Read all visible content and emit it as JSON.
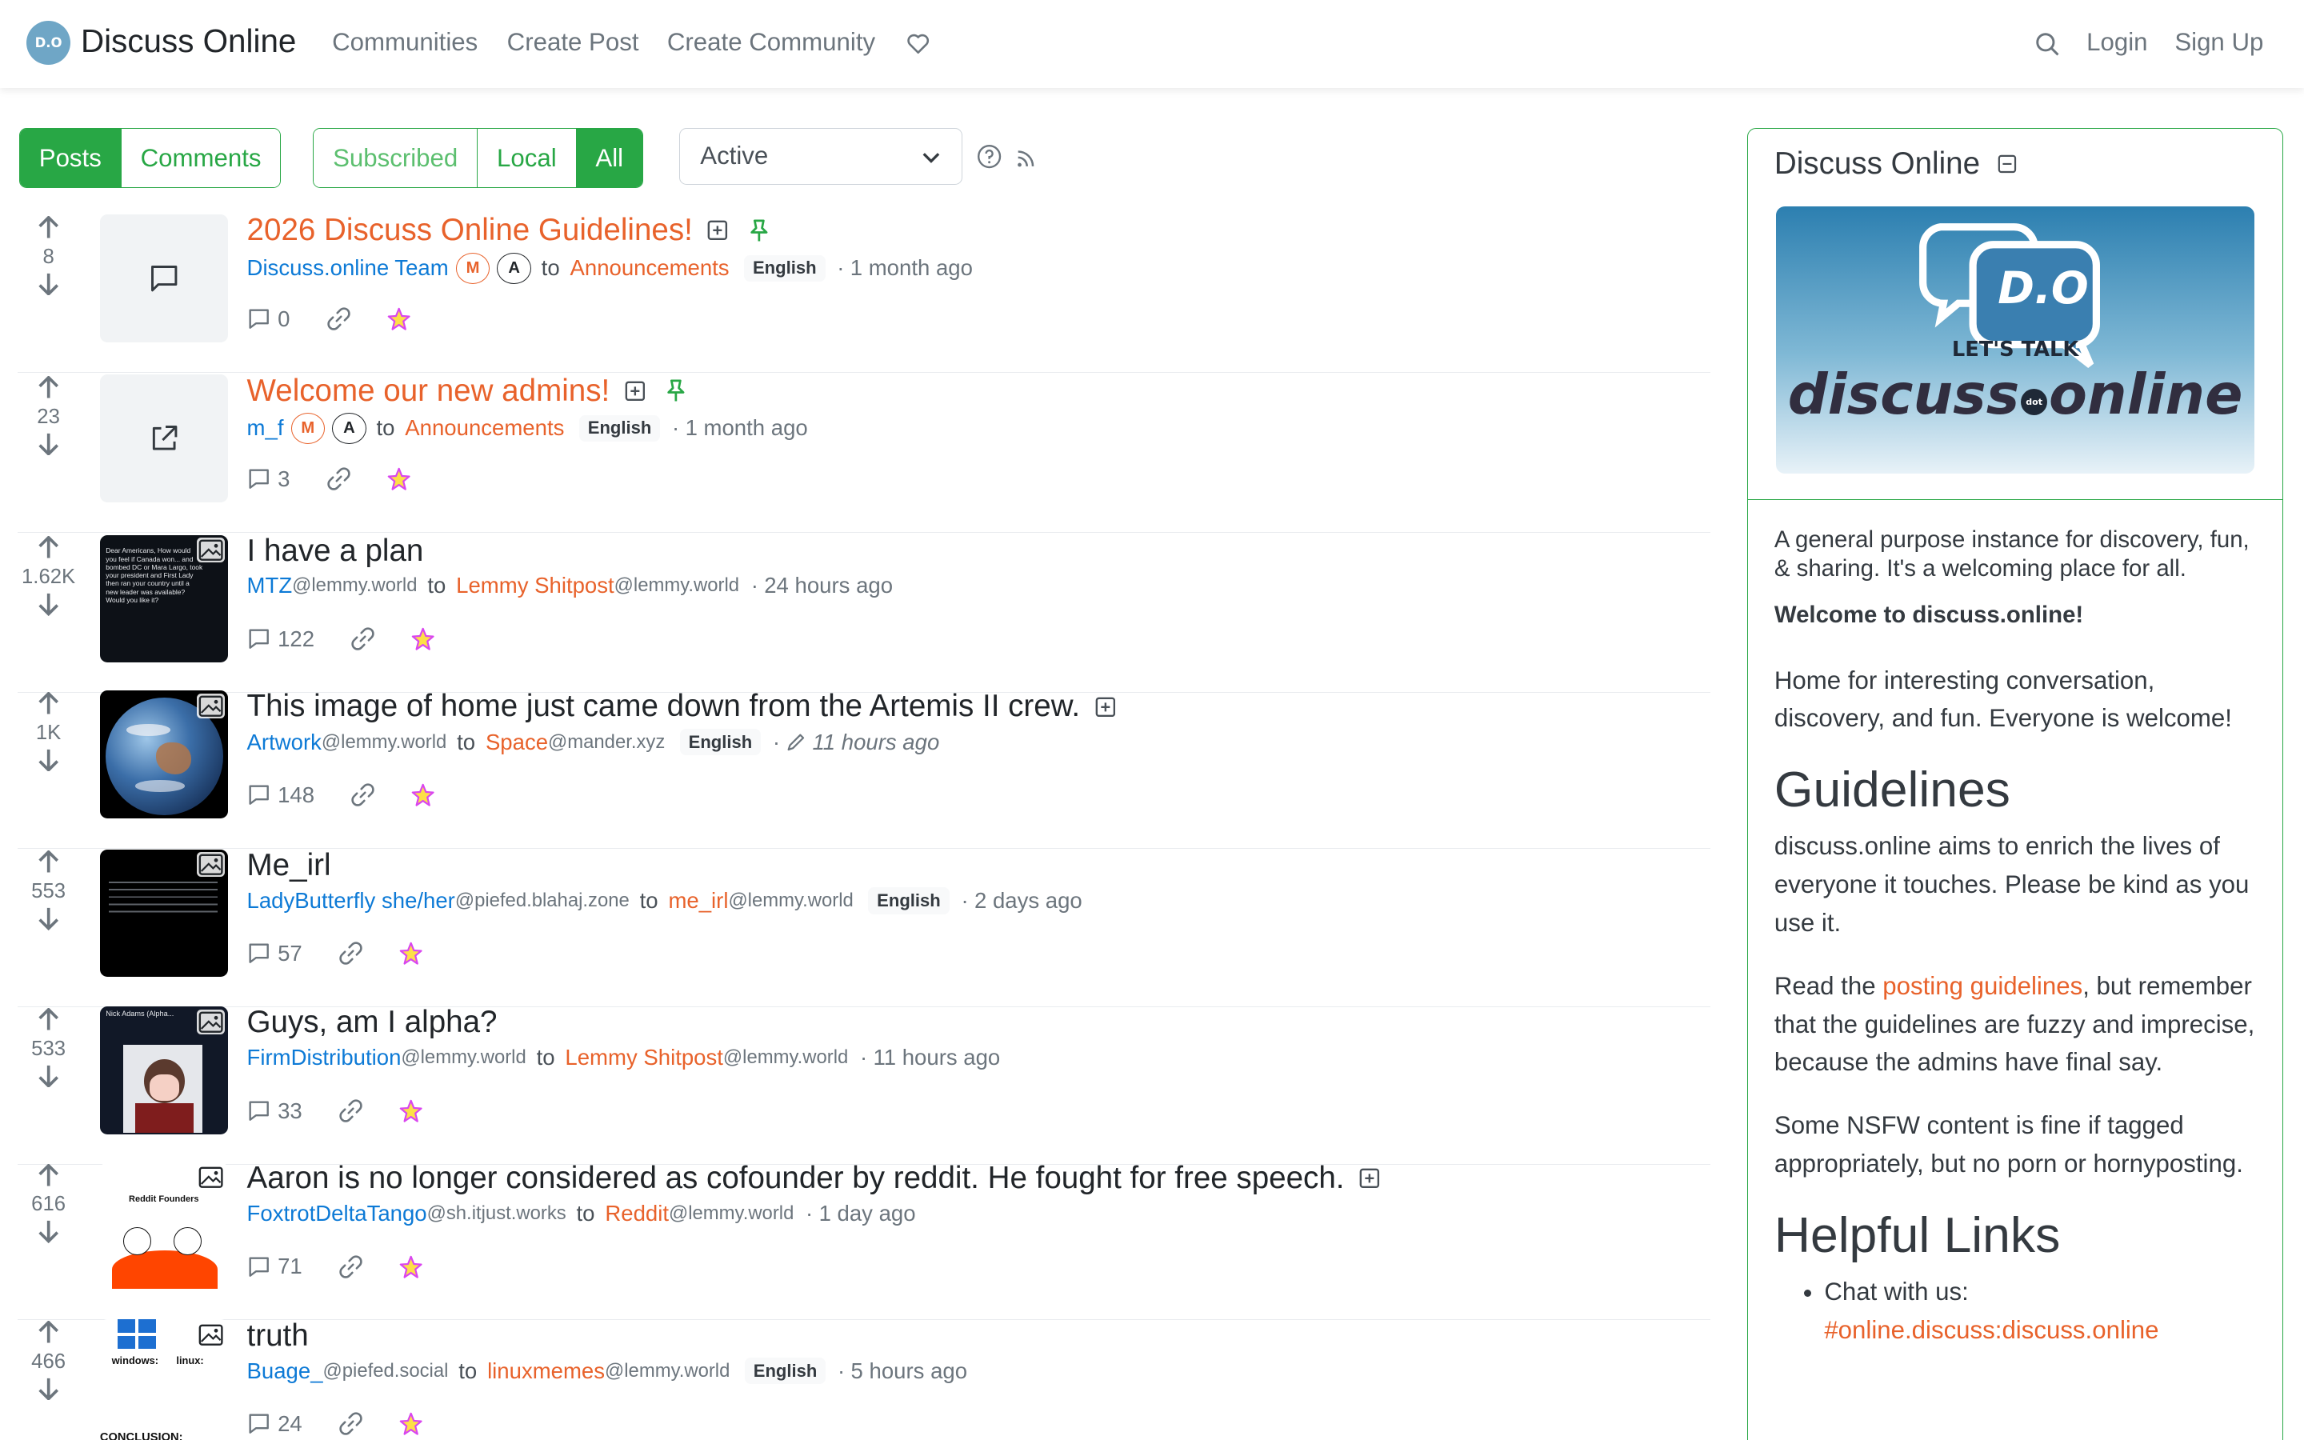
{
  "navbar": {
    "brand_logo_text": "D.O",
    "brand": "Discuss Online",
    "links": [
      "Communities",
      "Create Post",
      "Create Community"
    ],
    "login": "Login",
    "signup": "Sign Up"
  },
  "filters": {
    "type": [
      "Posts",
      "Comments"
    ],
    "listing": [
      "Subscribed",
      "Local",
      "All"
    ],
    "sort": "Active"
  },
  "posts": [
    {
      "score": "8",
      "title": "2026 Discuss Online Guidelines!",
      "creator": "Discuss.online Team",
      "creator_instance": "",
      "roles": [
        "M",
        "A"
      ],
      "to": "to",
      "community": "Announcements",
      "community_instance": "",
      "language": "English",
      "time": "1 month ago",
      "comments": "0",
      "thumb": "text-post-icon"
    },
    {
      "score": "23",
      "title": "Welcome our new admins!",
      "creator": "m_f",
      "creator_instance": "",
      "roles": [
        "M",
        "A"
      ],
      "to": "to",
      "community": "Announcements",
      "community_instance": "",
      "language": "English",
      "time": "1 month ago",
      "comments": "3",
      "thumb": "external-link-icon"
    },
    {
      "score": "1.62K",
      "title": "I have a plan",
      "creator": "MTZ",
      "creator_instance": "@lemmy.world",
      "to": "to",
      "community": "Lemmy Shitpost",
      "community_instance": "@lemmy.world",
      "language": "",
      "time": "24 hours ago",
      "comments": "122",
      "thumb": "image"
    },
    {
      "score": "1K",
      "title": "This image of home just came down from the Artemis II crew.",
      "creator": "Artwork",
      "creator_instance": "@lemmy.world",
      "to": "to",
      "community": "Space",
      "community_instance": "@mander.xyz",
      "language": "English",
      "time": "11 hours ago",
      "comments": "148",
      "thumb": "image"
    },
    {
      "score": "553",
      "title": "Me_irl",
      "creator": "LadyButterfly she/her",
      "creator_instance": "@piefed.blahaj.zone",
      "to": "to",
      "community": "me_irl",
      "community_instance": "@lemmy.world",
      "language": "English",
      "time": "2 days ago",
      "comments": "57",
      "thumb": "image"
    },
    {
      "score": "533",
      "title": "Guys, am I alpha?",
      "creator": "FirmDistribution",
      "creator_instance": "@lemmy.world",
      "to": "to",
      "community": "Lemmy Shitpost",
      "community_instance": "@lemmy.world",
      "language": "",
      "time": "11 hours ago",
      "comments": "33",
      "thumb": "image"
    },
    {
      "score": "616",
      "title": "Aaron is no longer considered as cofounder by reddit. He fought for free speech.",
      "creator": "FoxtrotDeltaTango",
      "creator_instance": "@sh.itjust.works",
      "to": "to",
      "community": "Reddit",
      "community_instance": "@lemmy.world",
      "language": "",
      "time": "1 day ago",
      "comments": "71",
      "thumb": "image"
    },
    {
      "score": "466",
      "title": "truth",
      "creator": "Buage_",
      "creator_instance": "@piefed.social",
      "to": "to",
      "community": "linuxmemes",
      "community_instance": "@lemmy.world",
      "language": "English",
      "time": "5 hours ago",
      "comments": "24",
      "thumb": "image"
    }
  ],
  "thumb_text": {
    "p5": "Dear Americans, How would you feel if Canada won... and bombed DC or Mara Largo, took your president and First Lady then ran your country until a new leader was available? Would you like it?",
    "p6": "Nick Adams (Alpha...",
    "p7_title": "Reddit Founders",
    "p8_windows": "windows:",
    "p8_linux": "linux:",
    "p8_bottom": "CONCLUSION:"
  },
  "sidebar": {
    "title": "Discuss Online",
    "banner_tagline": "LET'S TALK",
    "banner_brand_left": "discuss",
    "banner_brand_dot": "dot",
    "banner_brand_right": "online",
    "banner_logo": "D.O",
    "description": "A general purpose instance for discovery, fun, & sharing. It's a welcoming place for all.",
    "welcome": "Welcome to discuss.online!",
    "intro": "Home for interesting conversation, discovery, and fun. Everyone is welcome!",
    "guidelines_heading": "Guidelines",
    "guidelines_p1": "discuss.online aims to enrich the lives of everyone it touches. Please be kind as you use it.",
    "guidelines_read": "Read the ",
    "guidelines_link": "posting guidelines",
    "guidelines_rest": ", but remember that the guidelines are fuzzy and imprecise, because the admins have final say.",
    "nsfw": "Some NSFW content is fine if tagged appropriately, but no porn or hornyposting.",
    "links_heading": "Helpful Links",
    "chat_label": "Chat with us:",
    "chat_link": "#online.discuss:discuss.online"
  },
  "colors": {
    "accent": "#28a745",
    "featured": "#e8622b",
    "link": "#0d7ad6"
  }
}
